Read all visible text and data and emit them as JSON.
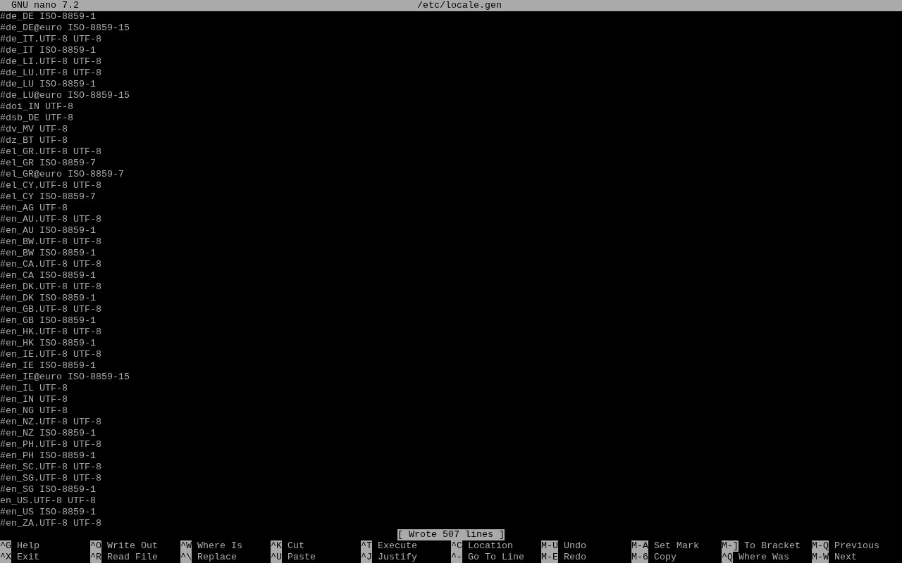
{
  "title_bar": {
    "app": "GNU nano 7.2",
    "file": "/etc/locale.gen"
  },
  "lines": [
    "#de_DE ISO-8859-1",
    "#de_DE@euro ISO-8859-15",
    "#de_IT.UTF-8 UTF-8",
    "#de_IT ISO-8859-1",
    "#de_LI.UTF-8 UTF-8",
    "#de_LU.UTF-8 UTF-8",
    "#de_LU ISO-8859-1",
    "#de_LU@euro ISO-8859-15",
    "#doi_IN UTF-8",
    "#dsb_DE UTF-8",
    "#dv_MV UTF-8",
    "#dz_BT UTF-8",
    "#el_GR.UTF-8 UTF-8",
    "#el_GR ISO-8859-7",
    "#el_GR@euro ISO-8859-7",
    "#el_CY.UTF-8 UTF-8",
    "#el_CY ISO-8859-7",
    "#en_AG UTF-8",
    "#en_AU.UTF-8 UTF-8",
    "#en_AU ISO-8859-1",
    "#en_BW.UTF-8 UTF-8",
    "#en_BW ISO-8859-1",
    "#en_CA.UTF-8 UTF-8",
    "#en_CA ISO-8859-1",
    "#en_DK.UTF-8 UTF-8",
    "#en_DK ISO-8859-1",
    "#en_GB.UTF-8 UTF-8",
    "#en_GB ISO-8859-1",
    "#en_HK.UTF-8 UTF-8",
    "#en_HK ISO-8859-1",
    "#en_IE.UTF-8 UTF-8",
    "#en_IE ISO-8859-1",
    "#en_IE@euro ISO-8859-15",
    "#en_IL UTF-8",
    "#en_IN UTF-8",
    "#en_NG UTF-8",
    "#en_NZ.UTF-8 UTF-8",
    "#en_NZ ISO-8859-1",
    "#en_PH.UTF-8 UTF-8",
    "#en_PH ISO-8859-1",
    "#en_SC.UTF-8 UTF-8",
    "#en_SG.UTF-8 UTF-8",
    "#en_SG ISO-8859-1",
    "en_US.UTF-8 UTF-8",
    "#en_US ISO-8859-1",
    "#en_ZA.UTF-8 UTF-8"
  ],
  "status_message": "[ Wrote 507 lines ]",
  "shortcuts": [
    [
      {
        "key": "^G",
        "label": "Help"
      },
      {
        "key": "^O",
        "label": "Write Out"
      },
      {
        "key": "^W",
        "label": "Where Is"
      },
      {
        "key": "^K",
        "label": "Cut"
      },
      {
        "key": "^T",
        "label": "Execute"
      },
      {
        "key": "^C",
        "label": "Location"
      },
      {
        "key": "M-U",
        "label": "Undo"
      },
      {
        "key": "M-A",
        "label": "Set Mark"
      },
      {
        "key": "M-]",
        "label": "To Bracket"
      },
      {
        "key": "M-Q",
        "label": "Previous"
      }
    ],
    [
      {
        "key": "^X",
        "label": "Exit"
      },
      {
        "key": "^R",
        "label": "Read File"
      },
      {
        "key": "^\\",
        "label": "Replace"
      },
      {
        "key": "^U",
        "label": "Paste"
      },
      {
        "key": "^J",
        "label": "Justify"
      },
      {
        "key": "^-",
        "label": "Go To Line"
      },
      {
        "key": "M-E",
        "label": "Redo"
      },
      {
        "key": "M-6",
        "label": "Copy"
      },
      {
        "key": "^Q",
        "label": "Where Was"
      },
      {
        "key": "M-W",
        "label": "Next"
      }
    ]
  ]
}
